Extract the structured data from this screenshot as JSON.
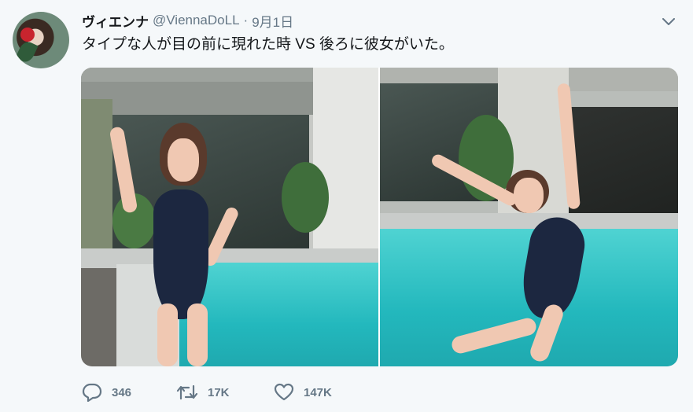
{
  "tweet": {
    "display_name": "ヴィエンナ",
    "handle": "@ViennaDoLL",
    "separator": "·",
    "timestamp": "9月1日",
    "text": "タイプな人が目の前に現れた時 VS 後ろに彼女がいた。"
  },
  "actions": {
    "reply_count": "346",
    "retweet_count": "17K",
    "like_count": "147K"
  },
  "icons": {
    "caret": "chevron-down-icon",
    "reply": "reply-icon",
    "retweet": "retweet-icon",
    "like": "heart-icon"
  },
  "colors": {
    "background": "#f5f8fa",
    "text": "#14171a",
    "secondary_text": "#657786"
  }
}
